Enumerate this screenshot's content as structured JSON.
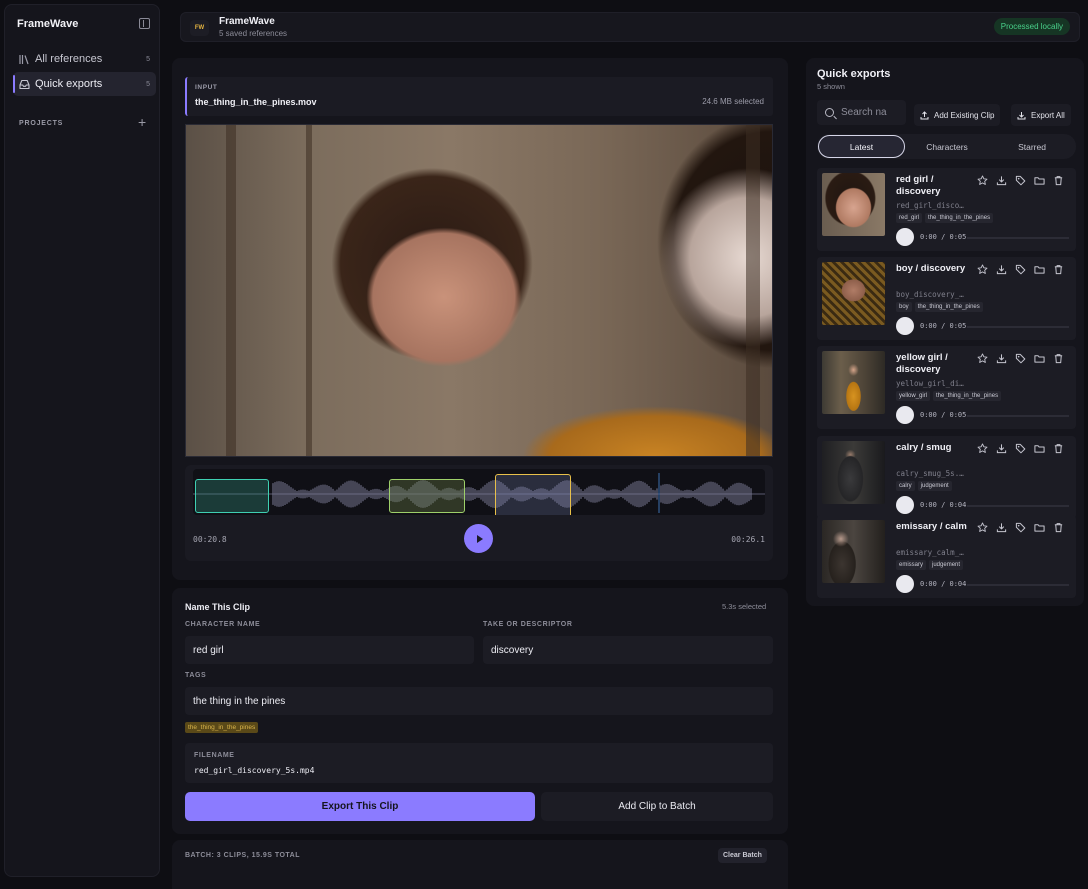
{
  "sidebar": {
    "brand": "FrameWave",
    "nav": [
      {
        "label": "All references",
        "count": "5",
        "icon": "library-icon"
      },
      {
        "label": "Quick exports",
        "count": "5",
        "icon": "inbox-icon"
      }
    ],
    "section_label": "PROJECTS",
    "add_icon": "plus-icon"
  },
  "header": {
    "logo": "FW",
    "title": "FrameWave",
    "subtitle": "5 saved references",
    "badge": "Processed locally",
    "badge_color": "#49d08a"
  },
  "input": {
    "label": "INPUT",
    "filename": "the_thing_in_the_pines.mov",
    "size": "24.6 MB selected"
  },
  "timeline": {
    "start": "00:20.8",
    "end": "00:26.1"
  },
  "form": {
    "title": "Name This Clip",
    "meta": "5.3s selected",
    "character_label": "CHARACTER NAME",
    "character_value": "red girl",
    "take_label": "TAKE OR DESCRIPTOR",
    "take_value": "discovery",
    "tags_label": "TAGS",
    "tags_value": "the thing in the pines",
    "tag_chip": "the_thing_in_the_pines",
    "filename_label": "FILENAME",
    "filename_value": "red_girl_discovery_5s.mp4",
    "export_button": "Export This Clip",
    "batch_button": "Add Clip to Batch"
  },
  "batch": {
    "summary": "BATCH: 3 CLIPS, 15.9S TOTAL",
    "clear_button": "Clear Batch"
  },
  "quick_exports": {
    "title": "Quick exports",
    "subtitle": "5 shown",
    "search_placeholder": "Search na",
    "add_existing": "Add Existing Clip",
    "export_all": "Export All",
    "tabs": [
      "Latest",
      "Characters",
      "Starred"
    ],
    "clips": [
      {
        "title": "red girl / discovery",
        "file": "red_girl_disco…",
        "tags": [
          "red_girl",
          "the_thing_in_the_pines"
        ],
        "time": "0:00 / 0:05"
      },
      {
        "title": "boy / discovery",
        "file": "boy_discovery_…",
        "tags": [
          "boy",
          "the_thing_in_the_pines"
        ],
        "time": "0:00 / 0:05"
      },
      {
        "title": "yellow girl / discovery",
        "file": "yellow_girl_di…",
        "tags": [
          "yellow_girl",
          "the_thing_in_the_pines"
        ],
        "time": "0:00 / 0:05"
      },
      {
        "title": "calry / smug",
        "file": "calry_smug_5s.…",
        "tags": [
          "calry",
          "judgement"
        ],
        "time": "0:00 / 0:04"
      },
      {
        "title": "emissary / calm",
        "file": "emissary_calm_…",
        "tags": [
          "emissary",
          "judgement"
        ],
        "time": "0:00 / 0:04"
      }
    ]
  },
  "colors": {
    "accent": "#8b7bff",
    "tag_gold": "#d8b34a"
  }
}
